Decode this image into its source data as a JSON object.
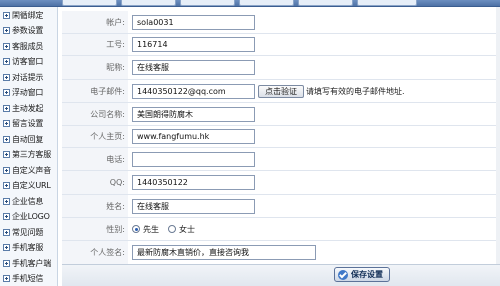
{
  "sidebar": {
    "items": [
      {
        "label": "閑循绑定"
      },
      {
        "label": "参数设置"
      },
      {
        "label": "客服成员"
      },
      {
        "label": "访客窗口"
      },
      {
        "label": "对话提示"
      },
      {
        "label": "浮动窗口"
      },
      {
        "label": "主动发起"
      },
      {
        "label": "留言设置"
      },
      {
        "label": "自动回复"
      },
      {
        "label": "第三方客服"
      },
      {
        "label": "自定义声音"
      },
      {
        "label": "自定义URL"
      },
      {
        "label": "企业信息"
      },
      {
        "label": "企业LOGO"
      },
      {
        "label": "常见问题"
      },
      {
        "label": "手机客服"
      },
      {
        "label": "手机客户端"
      },
      {
        "label": "手机短信"
      }
    ]
  },
  "form": {
    "account": {
      "label": "帐户:",
      "value": "sola0031"
    },
    "job_no": {
      "label": "工号:",
      "value": "116714"
    },
    "nickname": {
      "label": "昵称:",
      "value": "在线客服"
    },
    "email": {
      "label": "电子邮件:",
      "value": "1440350122@qq.com",
      "verify_button": "点击验证",
      "hint": "请填写有效的电子邮件地址."
    },
    "company": {
      "label": "公司名称:",
      "value": "美国朗得防腐木"
    },
    "homepage": {
      "label": "个人主页:",
      "value": "www.fangfumu.hk"
    },
    "phone": {
      "label": "电话:",
      "value": ""
    },
    "qq": {
      "label": "QQ:",
      "value": "1440350122"
    },
    "name": {
      "label": "姓名:",
      "value": "在线客服"
    },
    "gender": {
      "label": "性别:",
      "options": [
        "先生",
        "女士"
      ],
      "selected": "先生"
    },
    "signature": {
      "label": "个人签名:",
      "value": "最新防腐木直销价，直接咨询我"
    }
  },
  "footer": {
    "save_label": "保存设置"
  }
}
